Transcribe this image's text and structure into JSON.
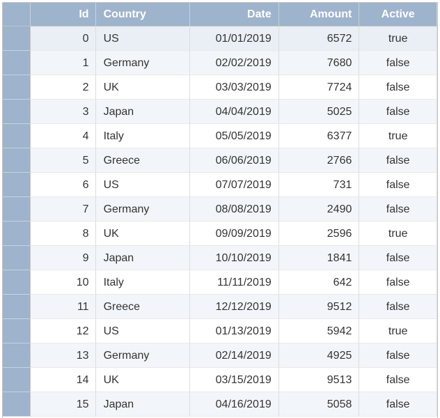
{
  "columns": {
    "id": "Id",
    "country": "Country",
    "date": "Date",
    "amount": "Amount",
    "active": "Active"
  },
  "colors": {
    "header_bg": "#9eb3cc",
    "row_alt": "#f2f6fa",
    "row_selected": "#e9eff5"
  },
  "rows": [
    {
      "id": "0",
      "country": "US",
      "date": "01/01/2019",
      "amount": "6572",
      "active": "true"
    },
    {
      "id": "1",
      "country": "Germany",
      "date": "02/02/2019",
      "amount": "7680",
      "active": "false"
    },
    {
      "id": "2",
      "country": "UK",
      "date": "03/03/2019",
      "amount": "7724",
      "active": "false"
    },
    {
      "id": "3",
      "country": "Japan",
      "date": "04/04/2019",
      "amount": "5025",
      "active": "false"
    },
    {
      "id": "4",
      "country": "Italy",
      "date": "05/05/2019",
      "amount": "6377",
      "active": "true"
    },
    {
      "id": "5",
      "country": "Greece",
      "date": "06/06/2019",
      "amount": "2766",
      "active": "false"
    },
    {
      "id": "6",
      "country": "US",
      "date": "07/07/2019",
      "amount": "731",
      "active": "false"
    },
    {
      "id": "7",
      "country": "Germany",
      "date": "08/08/2019",
      "amount": "2490",
      "active": "false"
    },
    {
      "id": "8",
      "country": "UK",
      "date": "09/09/2019",
      "amount": "2596",
      "active": "true"
    },
    {
      "id": "9",
      "country": "Japan",
      "date": "10/10/2019",
      "amount": "1841",
      "active": "false"
    },
    {
      "id": "10",
      "country": "Italy",
      "date": "11/11/2019",
      "amount": "642",
      "active": "false"
    },
    {
      "id": "11",
      "country": "Greece",
      "date": "12/12/2019",
      "amount": "9512",
      "active": "false"
    },
    {
      "id": "12",
      "country": "US",
      "date": "01/13/2019",
      "amount": "5942",
      "active": "true"
    },
    {
      "id": "13",
      "country": "Germany",
      "date": "02/14/2019",
      "amount": "4925",
      "active": "false"
    },
    {
      "id": "14",
      "country": "UK",
      "date": "03/15/2019",
      "amount": "9513",
      "active": "false"
    },
    {
      "id": "15",
      "country": "Japan",
      "date": "04/16/2019",
      "amount": "5058",
      "active": "false"
    }
  ]
}
